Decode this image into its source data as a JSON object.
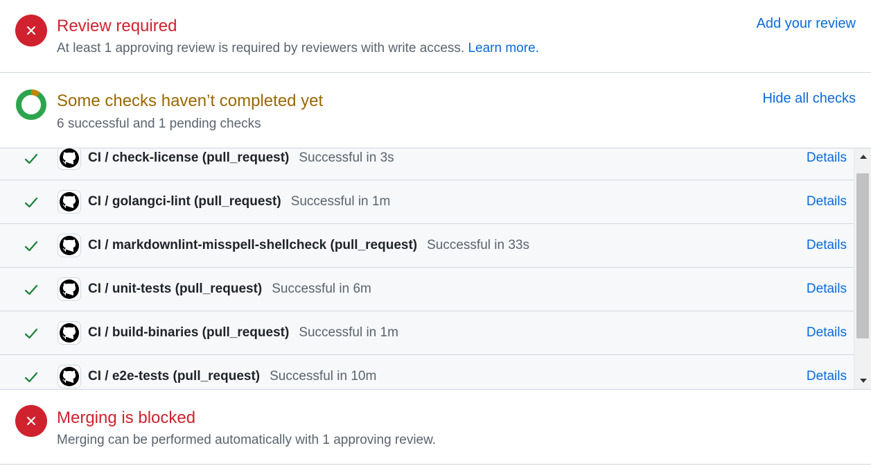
{
  "review": {
    "title": "Review required",
    "description": "At least 1 approving review is required by reviewers with write access.",
    "learn_more": "Learn more.",
    "action": "Add your review",
    "icon": "x-circle-icon"
  },
  "checks": {
    "title": "Some checks haven’t completed yet",
    "summary": "6 successful and 1 pending checks",
    "action": "Hide all checks",
    "icon": "donut-progress-icon",
    "progress_successful": 6,
    "progress_pending": 1,
    "items": [
      {
        "name": "CI / check-license (pull_request)",
        "status": "Successful in 3s",
        "details": "Details"
      },
      {
        "name": "CI / golangci-lint (pull_request)",
        "status": "Successful in 1m",
        "details": "Details"
      },
      {
        "name": "CI / markdownlint-misspell-shellcheck (pull_request)",
        "status": "Successful in 33s",
        "details": "Details"
      },
      {
        "name": "CI / unit-tests (pull_request)",
        "status": "Successful in 6m",
        "details": "Details"
      },
      {
        "name": "CI / build-binaries (pull_request)",
        "status": "Successful in 1m",
        "details": "Details"
      },
      {
        "name": "CI / e2e-tests (pull_request)",
        "status": "Successful in 10m",
        "details": "Details"
      }
    ]
  },
  "merge": {
    "title": "Merging is blocked",
    "description": "Merging can be performed automatically with 1 approving review.",
    "icon": "x-circle-icon"
  },
  "colors": {
    "danger": "#cf222e",
    "attention": "#9a6700",
    "success": "#1a7f37",
    "link": "#0969da",
    "pending": "#bf8700"
  }
}
